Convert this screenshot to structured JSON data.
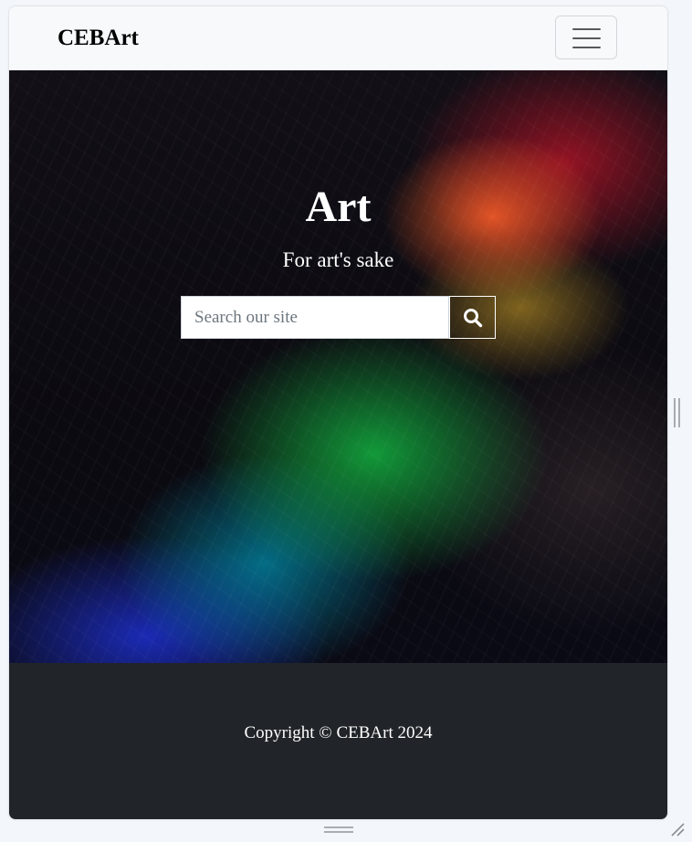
{
  "navbar": {
    "brand": "CEBArt",
    "toggler_icon": "hamburger-menu-icon"
  },
  "hero": {
    "title": "Art",
    "subtitle": "For art's sake",
    "search": {
      "placeholder": "Search our site",
      "value": "",
      "button_icon": "search-icon"
    }
  },
  "footer": {
    "copyright": "Copyright © CEBArt 2024"
  },
  "colors": {
    "navbar_bg": "#f8f9fa",
    "footer_bg": "#212529",
    "hero_text": "#ffffff"
  }
}
